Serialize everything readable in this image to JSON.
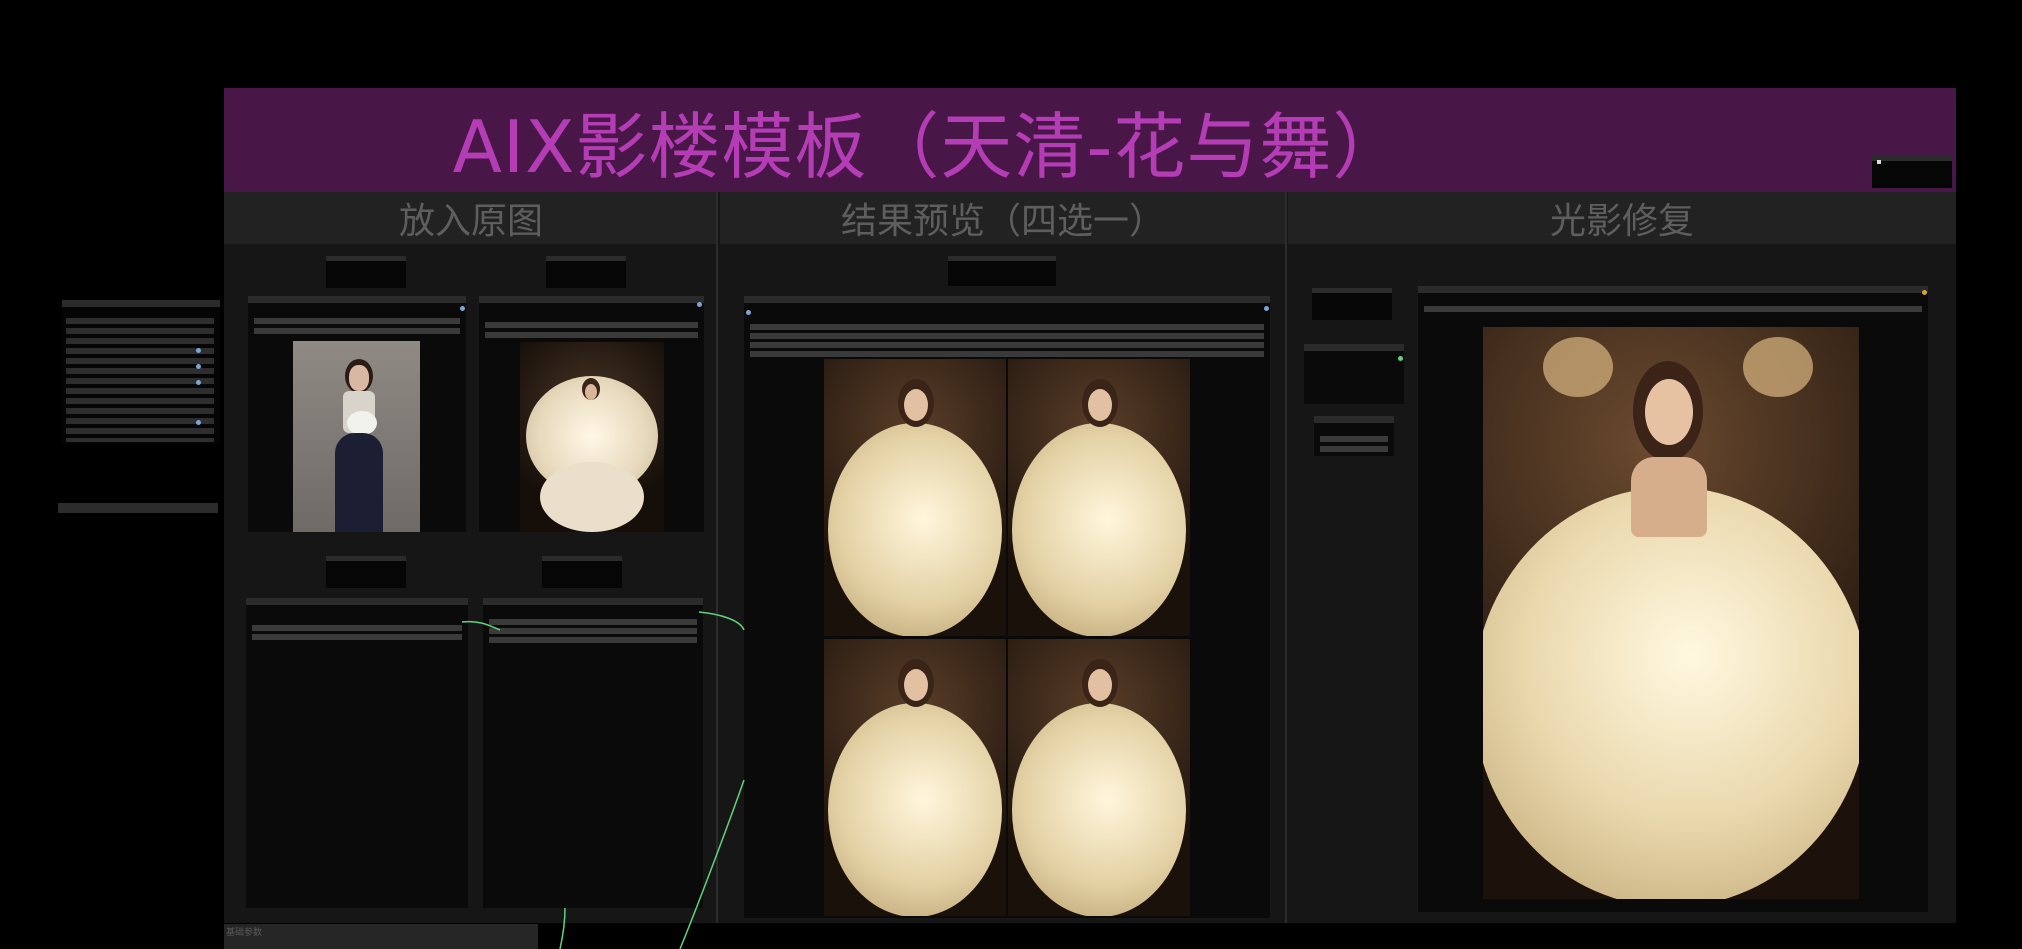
{
  "group": {
    "title": "AIX影楼模板（天清-花与舞）"
  },
  "sections": [
    {
      "key": "input",
      "label": "放入原图"
    },
    {
      "key": "preview",
      "label": "结果预览（四选一）"
    },
    {
      "key": "relight",
      "label": "光影修复"
    }
  ],
  "footer": {
    "params_label": "基础参数"
  },
  "images": {
    "original_photo": "original-photo",
    "reference_template": "reference-template",
    "preview_grid": "preview-grid",
    "relight_result": "relight-result"
  },
  "colors": {
    "title_bar": "#491747",
    "title_text": "#b43db5",
    "canvas_bg": "#000000",
    "group_bg": "#161616",
    "link_green": "#5fd37e"
  }
}
